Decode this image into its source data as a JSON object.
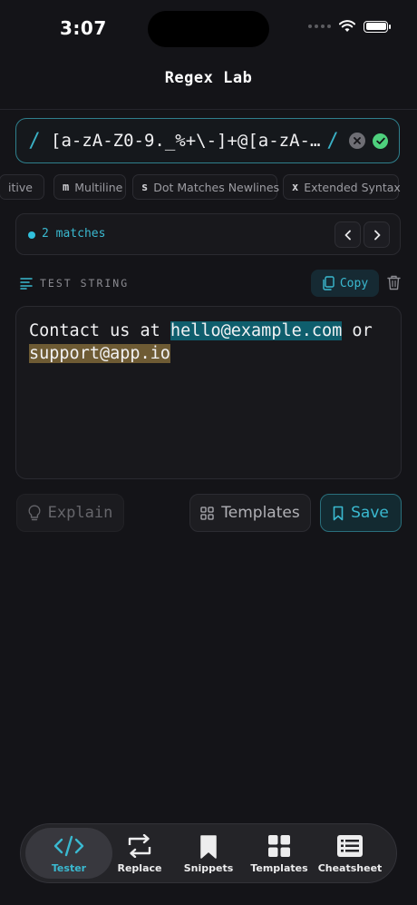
{
  "status": {
    "time": "3:07"
  },
  "app": {
    "title": "Regex Lab"
  },
  "regex": {
    "pattern": "[a-zA-Z0-9._%+\\-]+@[a-zA-…",
    "delimiter": "/"
  },
  "flags": [
    {
      "key": "",
      "label": "itive"
    },
    {
      "key": "m",
      "label": "Multiline"
    },
    {
      "key": "s",
      "label": "Dot Matches Newlines"
    },
    {
      "key": "x",
      "label": "Extended Syntax"
    }
  ],
  "matches": {
    "count_label": "2 matches"
  },
  "test_section": {
    "label": "TEST STRING",
    "copy_label": "Copy"
  },
  "test_string": {
    "before": "Contact us at ",
    "match1": "hello@example.com",
    "between": " or",
    "match2": "support@app.io"
  },
  "actions": {
    "explain": "Explain",
    "templates": "Templates",
    "save": "Save"
  },
  "tabs": [
    {
      "label": "Tester",
      "icon": "code-icon",
      "active": true
    },
    {
      "label": "Replace",
      "icon": "replace-icon"
    },
    {
      "label": "Snippets",
      "icon": "bookmark-icon"
    },
    {
      "label": "Templates",
      "icon": "grid-icon"
    },
    {
      "label": "Cheatsheet",
      "icon": "list-icon"
    }
  ],
  "colors": {
    "accent": "#3ab9d0",
    "match1": "#0f5e6d",
    "match2": "#6e5b34",
    "valid": "#4ed07d"
  }
}
